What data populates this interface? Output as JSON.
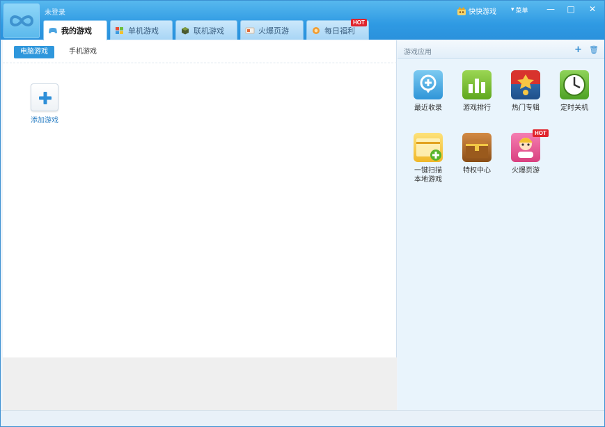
{
  "user": {
    "login_text": "未登录"
  },
  "brand": {
    "name": "快快游戏",
    "icon": "crown-icon"
  },
  "window": {
    "menu_label": "菜单",
    "menu_icon": "caret-down-icon",
    "minimize": "—",
    "maximize": "□",
    "close": "✕"
  },
  "tabs": [
    {
      "label": "我的游戏",
      "icon": "gamepad-icon",
      "active": true
    },
    {
      "label": "单机游戏",
      "icon": "windows-icon",
      "active": false
    },
    {
      "label": "联机游戏",
      "icon": "cube-icon",
      "active": false
    },
    {
      "label": "火爆页游",
      "icon": "card-icon",
      "active": false
    },
    {
      "label": "每日福利",
      "icon": "gift-icon",
      "active": false,
      "badge": "HOT"
    }
  ],
  "subtabs": [
    {
      "label": "电脑游戏",
      "active": true
    },
    {
      "label": "手机游戏",
      "active": false
    }
  ],
  "add_game": {
    "label": "添加游戏",
    "icon": "plus-icon"
  },
  "right_panel": {
    "title": "游戏应用",
    "add_icon": "+",
    "delete_icon": "🗑",
    "apps": [
      {
        "label": "最近收录",
        "icon": "location-pin-icon",
        "color": "#3aa6e0"
      },
      {
        "label": "游戏排行",
        "icon": "bar-chart-icon",
        "color": "#7cc12e"
      },
      {
        "label": "热门专辑",
        "icon": "album-icon",
        "color": "#2f6fb0"
      },
      {
        "label": "定时关机",
        "icon": "clock-icon",
        "color": "#6cbb3c"
      },
      {
        "label": "一键扫描\n本地游戏",
        "line1": "一键扫描",
        "line2": "本地游戏",
        "icon": "folder-plus-icon",
        "color": "#f2c43c"
      },
      {
        "label": "特权中心",
        "icon": "treasure-chest-icon",
        "color": "#a8672a"
      },
      {
        "label": "火爆页游",
        "icon": "game-character-icon",
        "color": "#e8508f",
        "badge": "HOT"
      }
    ]
  }
}
